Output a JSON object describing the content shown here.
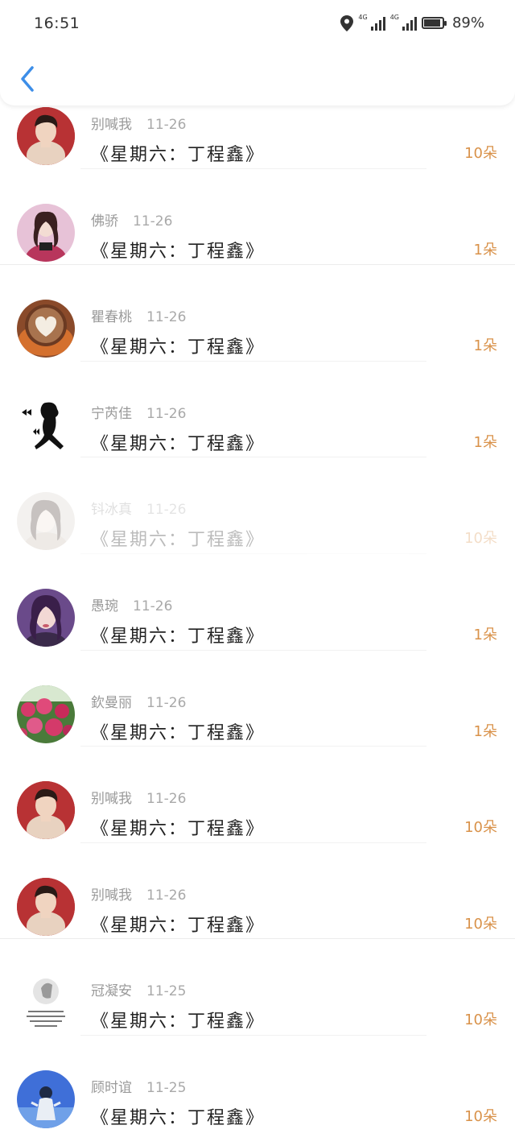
{
  "status_bar": {
    "time": "16:51",
    "network_1": "4G",
    "network_2": "4G",
    "battery_percent": "89%",
    "battery_level": 0.89,
    "icons": [
      "location-icon",
      "signal-icon",
      "signal-icon",
      "battery-icon"
    ]
  },
  "header": {
    "back_icon": "chevron-left-icon",
    "accent_color": "#3d8ee8"
  },
  "colors": {
    "count": "#d9924a",
    "name": "#9a9a9a",
    "title": "#222222"
  },
  "list": [
    {
      "name": "别喊我",
      "date": "11-26",
      "title": "《星期六：丁程鑫》",
      "count": "10朵",
      "avatar": "avatar-boy",
      "faded": false,
      "divider": "inner"
    },
    {
      "name": "佛骄",
      "date": "11-26",
      "title": "《星期六：丁程鑫》",
      "count": "1朵",
      "avatar": "avatar-girl-pink",
      "faded": false,
      "divider": "full"
    },
    {
      "name": "瞿春桃",
      "date": "11-26",
      "title": "《星期六：丁程鑫》",
      "count": "1朵",
      "avatar": "avatar-latte-heart",
      "faded": false,
      "divider": "inner"
    },
    {
      "name": "宁芮佳",
      "date": "11-26",
      "title": "《星期六：丁程鑫》",
      "count": "1朵",
      "avatar": "avatar-silhouette",
      "faded": false,
      "divider": "inner"
    },
    {
      "name": "钭冰真",
      "date": "11-26",
      "title": "《星期六：丁程鑫》",
      "count": "10朵",
      "avatar": "avatar-girl-light",
      "faded": true,
      "divider": "inner"
    },
    {
      "name": "愚琬",
      "date": "11-26",
      "title": "《星期六：丁程鑫》",
      "count": "1朵",
      "avatar": "avatar-girl-purple",
      "faded": false,
      "divider": "inner"
    },
    {
      "name": "欽曼丽",
      "date": "11-26",
      "title": "《星期六：丁程鑫》",
      "count": "1朵",
      "avatar": "avatar-flowers",
      "faded": false,
      "divider": "inner"
    },
    {
      "name": "别喊我",
      "date": "11-26",
      "title": "《星期六：丁程鑫》",
      "count": "10朵",
      "avatar": "avatar-boy",
      "faded": false,
      "divider": "inner"
    },
    {
      "name": "别喊我",
      "date": "11-26",
      "title": "《星期六：丁程鑫》",
      "count": "10朵",
      "avatar": "avatar-boy",
      "faded": false,
      "divider": "full"
    },
    {
      "name": "冠凝安",
      "date": "11-25",
      "title": "《星期六：丁程鑫》",
      "count": "10朵",
      "avatar": "avatar-text-card",
      "faded": false,
      "divider": "inner"
    },
    {
      "name": "顾时谊",
      "date": "11-25",
      "title": "《星期六：丁程鑫》",
      "count": "10朵",
      "avatar": "avatar-blue-sky",
      "faded": false,
      "divider": "none"
    }
  ]
}
